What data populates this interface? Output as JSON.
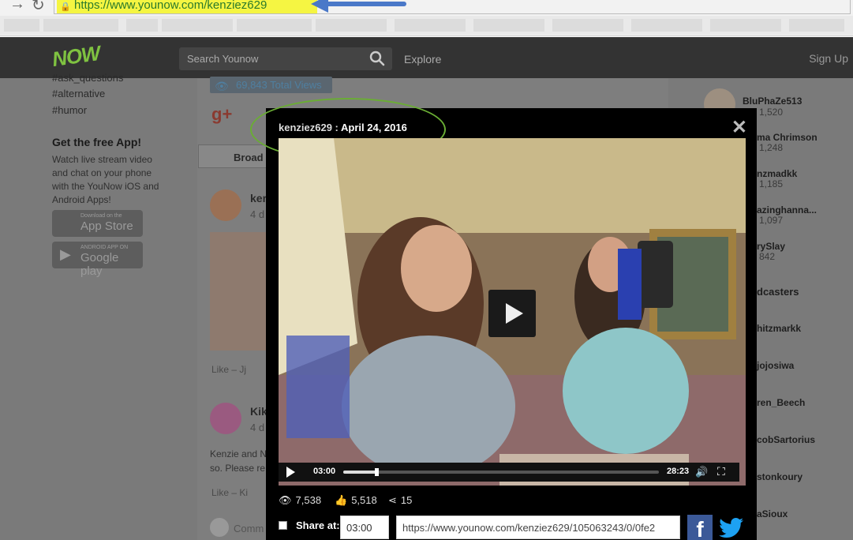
{
  "browser": {
    "url": "https://www.younow.com/kenziez629"
  },
  "header": {
    "logo": "NOW",
    "search_placeholder": "Search Younow",
    "explore": "Explore",
    "signup": "Sign Up"
  },
  "left": {
    "hashtags": [
      "#ask_questions",
      "#alternative",
      "#humor"
    ],
    "getapp_title": "Get the free App!",
    "getapp_desc": "Watch live stream video and chat on your phone with the YouNow iOS and Android Apps!",
    "appstore_small": "Download on the",
    "appstore_big": "App Store",
    "googleplay_small": "ANDROID APP ON",
    "googleplay_big": "Google play"
  },
  "feed": {
    "total_views": "69,843 Total Views",
    "broadcasts_tab": "Broad",
    "post1_name": "ker",
    "post1_time": "4 d",
    "post1_like": "Like – Jj",
    "post2_name": "Kik",
    "post2_time": "4 d",
    "post2_text_line1": "Kenzie and N",
    "post2_text_line2": "so. Please re",
    "post2_like": "Like – Ki",
    "comment": "Comm"
  },
  "right": {
    "users": [
      {
        "name": "BluPhaZe513",
        "count": "1,520"
      },
      {
        "name": "ma Chrimson",
        "count": "1,248"
      },
      {
        "name": "nzmadkk",
        "count": "1,185"
      },
      {
        "name": "azinghanna...",
        "count": "1,097"
      },
      {
        "name": "rySlay",
        "count": "842"
      }
    ],
    "broadcasters_heading": "dcasters",
    "broadcasters": [
      "hitzmarkk",
      "jojosiwa",
      "ren_Beech",
      "cobSartorius",
      "stonkoury",
      "aSioux"
    ]
  },
  "modal": {
    "username": "kenziez629",
    "separator": " : ",
    "date": "April 24, 2016",
    "current_time": "03:00",
    "duration": "28:23",
    "progress_fraction": 0.106,
    "views": "7,538",
    "likes": "5,518",
    "shares": "15",
    "share_label": "Share at:",
    "share_time": "03:00",
    "share_url": "https://www.younow.com/kenziez629/105063243/0/0fe2"
  },
  "colors": {
    "accent_green": "#7fc241",
    "facebook": "#3b5998",
    "twitter": "#1da1f2"
  }
}
